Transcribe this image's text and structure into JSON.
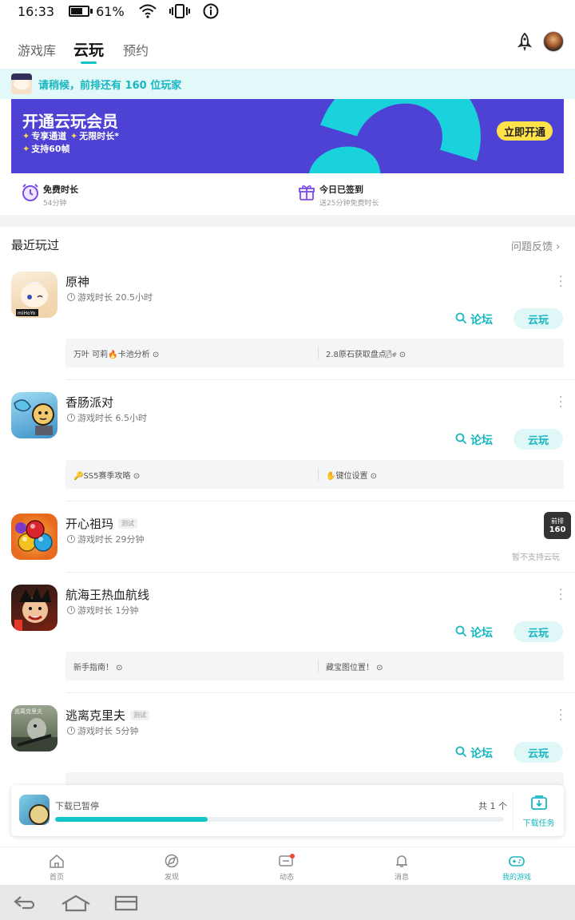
{
  "status_bar": {
    "time": "16:33",
    "battery": "61%"
  },
  "tabs": [
    {
      "label": "游戏库"
    },
    {
      "label": "云玩"
    },
    {
      "label": "预约"
    }
  ],
  "queue_text": "请稍候，前排还有 160 位玩家",
  "banner": {
    "title": "开通云玩会员",
    "features": [
      "专享通道",
      "无限时长*",
      "支持60帧"
    ],
    "button": "立即开通"
  },
  "perks": [
    {
      "label": "免费时长",
      "sub": "54分钟",
      "icon": "clock-icon"
    },
    {
      "label": "今日已签到",
      "sub": "送25分钟免费时长",
      "icon": "gift-icon"
    }
  ],
  "recent_title": "最近玩过",
  "feedback": "问题反馈",
  "forum_label": "论坛",
  "play_label": "云玩",
  "games": [
    {
      "name": "原神",
      "time": "游戏时长 20.5小时",
      "tag": "",
      "posts": [
        "万叶 可莉🔥卡池分析",
        "2.8原石获取盘点🌬"
      ]
    },
    {
      "name": "香肠派对",
      "time": "游戏时长 6.5小时",
      "tag": "",
      "posts": [
        "🔑SS5赛季攻略",
        "✋键位设置"
      ]
    },
    {
      "name": "开心祖玛",
      "time": "游戏时长 29分钟",
      "tag": "测试",
      "no_support": "暂不支持云玩",
      "badge_top": "前排",
      "badge_num": "160"
    },
    {
      "name": "航海王热血航线",
      "time": "游戏时长 1分钟",
      "tag": "",
      "posts": [
        "新手指南！",
        "藏宝图位置！"
      ]
    },
    {
      "name": "逃离克里夫",
      "time": "游戏时长 5分钟",
      "tag": "测试"
    }
  ],
  "download": {
    "status": "下载已暂停",
    "count": "共 1 个",
    "task": "下载任务",
    "progress": 0.34
  },
  "bottom_nav": [
    {
      "label": "首页",
      "icon": "home-icon"
    },
    {
      "label": "发现",
      "icon": "discover-icon"
    },
    {
      "label": "动态",
      "icon": "chat-icon"
    },
    {
      "label": "消息",
      "icon": "bell-icon"
    },
    {
      "label": "我的游戏",
      "icon": "gamepad-icon"
    }
  ],
  "colors": {
    "accent": "#17b7c0",
    "banner": "#4e42d4",
    "banner_wave": "#19d2dc",
    "button": "#ffe24a"
  }
}
